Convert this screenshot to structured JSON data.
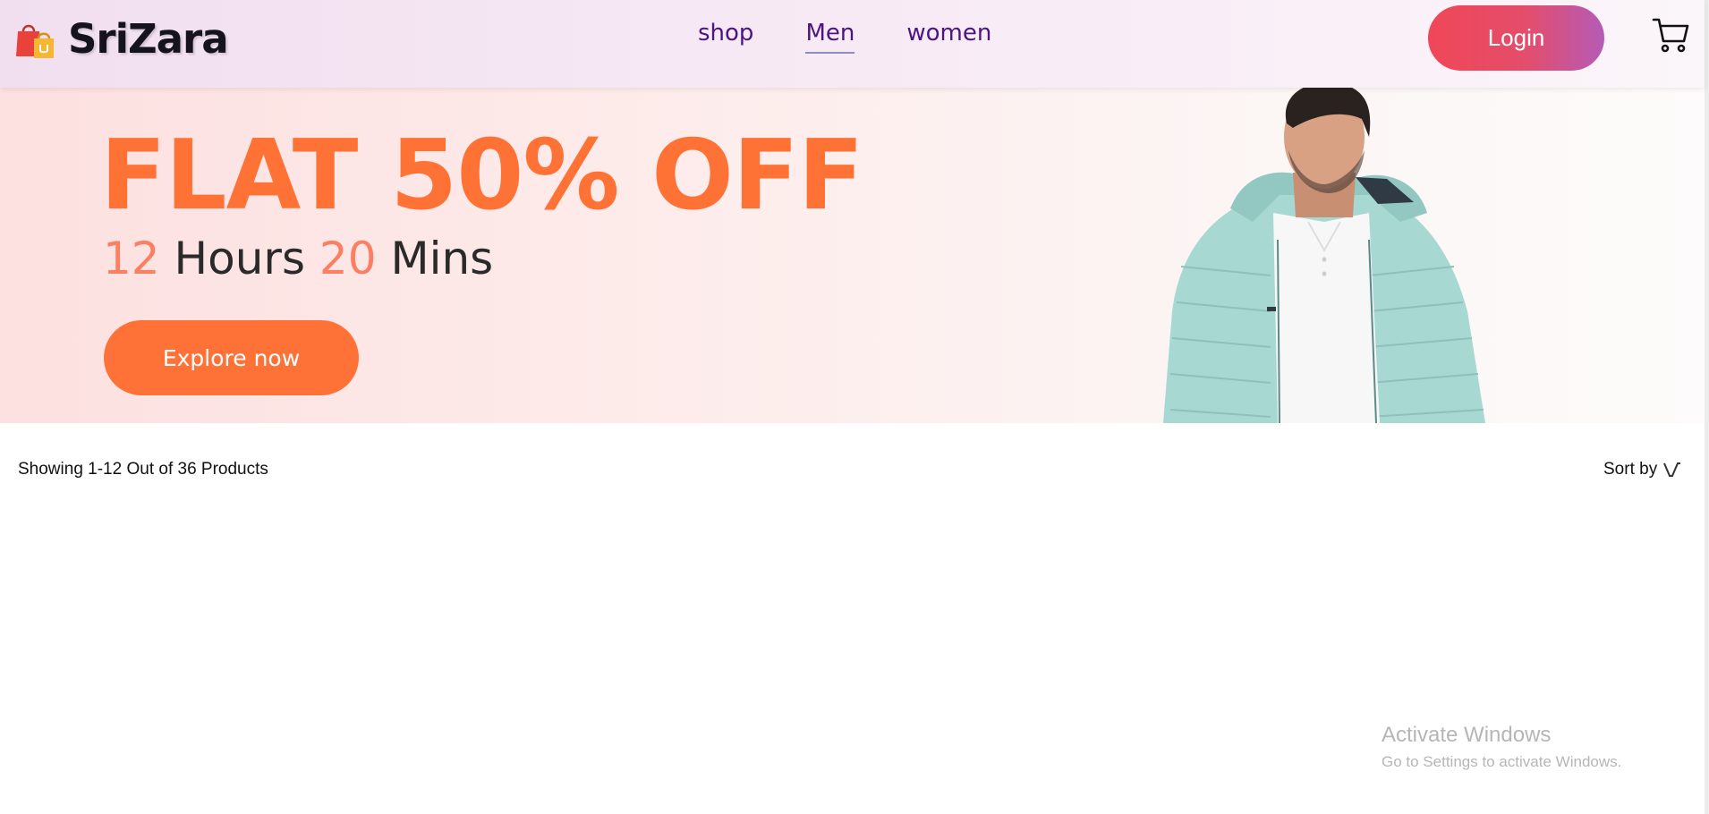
{
  "header": {
    "brand": "SriZara",
    "nav": [
      {
        "label": "shop",
        "active": false
      },
      {
        "label": "Men",
        "active": true
      },
      {
        "label": "women",
        "active": false
      }
    ],
    "login_label": "Login",
    "cart_icon": "cart-icon",
    "logo_icon": "shopping-bags-icon"
  },
  "banner": {
    "headline": "FLAT 50% OFF",
    "hours_value": "12",
    "hours_label": "Hours",
    "mins_value": "20",
    "mins_label": "Mins",
    "cta_label": "Explore now"
  },
  "products": {
    "showing_text": "Showing 1-12 Out of 36 Products",
    "sort_label": "Sort by"
  },
  "os_watermark": {
    "title": "Activate Windows",
    "subtitle": "Go to Settings to activate Windows."
  },
  "colors": {
    "accent_orange": "#ff7235",
    "nav_purple": "#4b1582",
    "login_gradient_start": "#f04757",
    "login_gradient_end": "#b55bb6"
  }
}
